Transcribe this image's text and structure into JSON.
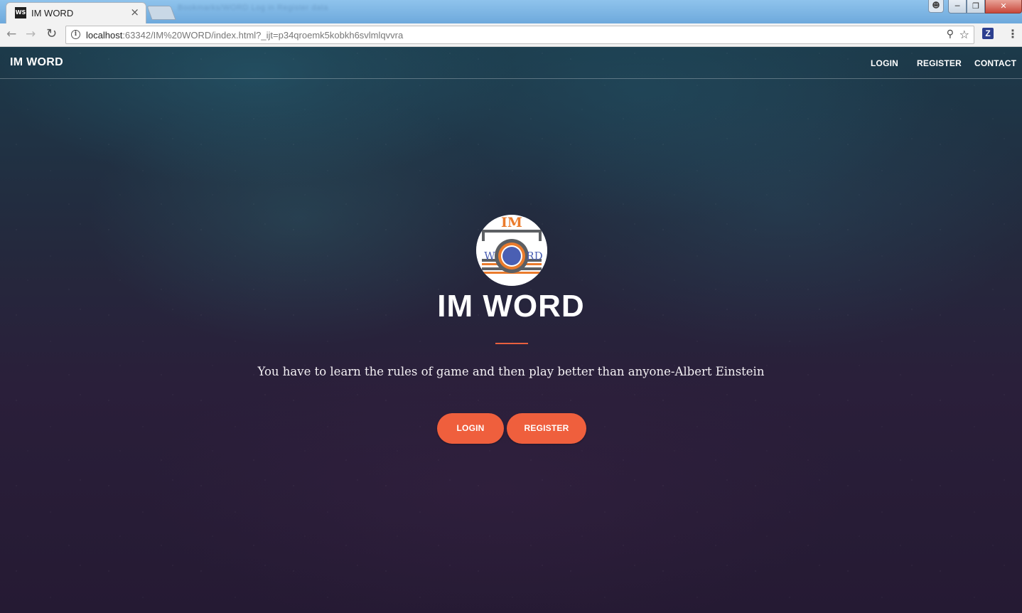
{
  "browser": {
    "tab_title": "IM WORD",
    "tab_favicon": "WS",
    "tab_close": "×",
    "blurred_tabs": "Bookmarks/WORD   Log in   Register   data",
    "url_host": "localhost",
    "url_rest": ":63342/IM%20WORD/index.html?_ijt=p34qroemk5kobkh6svlmlqvvra",
    "extension_label": "Z",
    "icons": [
      "back-arrow-icon",
      "forward-arrow-icon",
      "reload-icon",
      "info-icon",
      "zoom-icon",
      "star-icon",
      "extension-icon",
      "menu-icon",
      "user-icon",
      "minimize-icon",
      "maximize-icon",
      "close-icon"
    ]
  },
  "navbar": {
    "brand": "IM WORD",
    "links": [
      "LOGIN",
      "REGISTER",
      "CONTACT"
    ]
  },
  "logo": {
    "top_text": "IM",
    "left_text": "W",
    "right_text": "RD"
  },
  "hero": {
    "title": "IM WORD",
    "quote": "You have to learn the rules of game and then play better than anyone-Albert Einstein",
    "buttons": [
      "LOGIN",
      "REGISTER"
    ]
  },
  "colors": {
    "accent": "#ef5f3d",
    "logo_orange": "#ea7b2c",
    "logo_blue": "#4a5fb3",
    "logo_gray": "#5c5f63"
  }
}
